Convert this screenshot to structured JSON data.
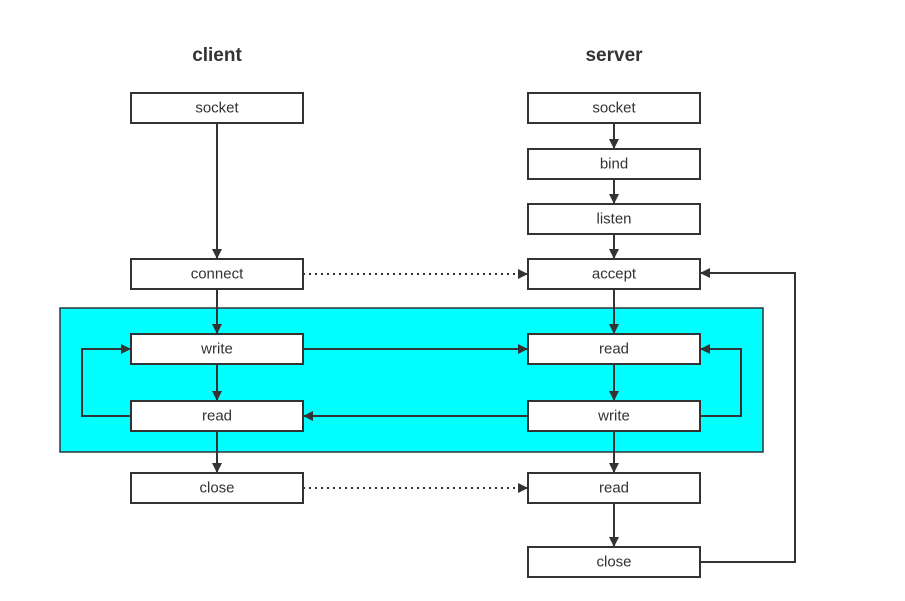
{
  "titles": {
    "client": "client",
    "server": "server"
  },
  "highlight_color": "#00FFFF",
  "client": [
    {
      "id": "c_socket",
      "label": "socket"
    },
    {
      "id": "c_connect",
      "label": "connect"
    },
    {
      "id": "c_write",
      "label": "write"
    },
    {
      "id": "c_read",
      "label": "read"
    },
    {
      "id": "c_close",
      "label": "close"
    }
  ],
  "server": [
    {
      "id": "s_socket",
      "label": "socket"
    },
    {
      "id": "s_bind",
      "label": "bind"
    },
    {
      "id": "s_listen",
      "label": "listen"
    },
    {
      "id": "s_accept",
      "label": "accept"
    },
    {
      "id": "s_read",
      "label": "read"
    },
    {
      "id": "s_write",
      "label": "write"
    },
    {
      "id": "s_read2",
      "label": "read"
    },
    {
      "id": "s_close",
      "label": "close"
    }
  ],
  "edges": [
    {
      "from": "c_socket",
      "to": "c_connect",
      "style": "solid"
    },
    {
      "from": "c_connect",
      "to": "c_write",
      "style": "solid"
    },
    {
      "from": "c_write",
      "to": "c_read",
      "style": "solid"
    },
    {
      "from": "c_read",
      "to": "c_close",
      "style": "solid"
    },
    {
      "from": "c_read",
      "to": "c_write",
      "style": "loop"
    },
    {
      "from": "s_socket",
      "to": "s_bind",
      "style": "solid"
    },
    {
      "from": "s_bind",
      "to": "s_listen",
      "style": "solid"
    },
    {
      "from": "s_listen",
      "to": "s_accept",
      "style": "solid"
    },
    {
      "from": "s_accept",
      "to": "s_read",
      "style": "solid"
    },
    {
      "from": "s_read",
      "to": "s_write",
      "style": "solid"
    },
    {
      "from": "s_write",
      "to": "s_read2",
      "style": "solid"
    },
    {
      "from": "s_read2",
      "to": "s_close",
      "style": "solid"
    },
    {
      "from": "s_write",
      "to": "s_read",
      "style": "loop"
    },
    {
      "from": "s_close",
      "to": "s_accept",
      "style": "loop"
    },
    {
      "from": "c_connect",
      "to": "s_accept",
      "style": "dotted"
    },
    {
      "from": "c_write",
      "to": "s_read",
      "style": "solid"
    },
    {
      "from": "s_write",
      "to": "c_read",
      "style": "solid"
    },
    {
      "from": "c_close",
      "to": "s_read2",
      "style": "dotted"
    }
  ]
}
